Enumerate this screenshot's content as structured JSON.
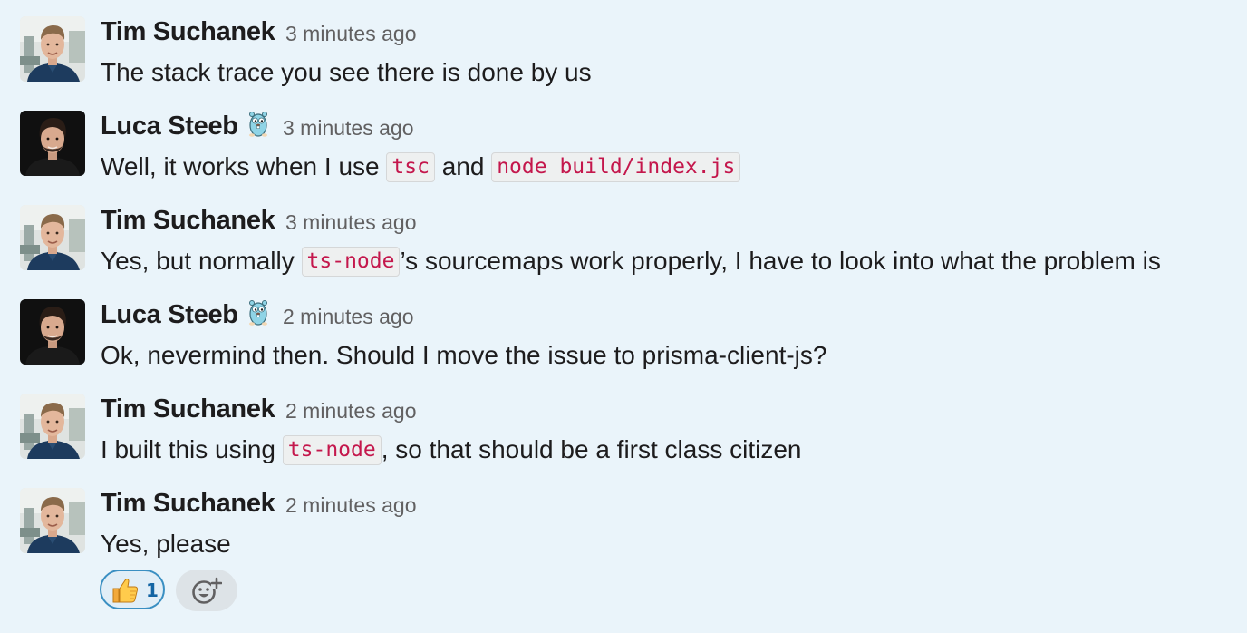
{
  "messages": [
    {
      "author": "Tim Suchanek",
      "avatar_icon": "avatar-tim-suchanek",
      "timestamp": "3 minutes ago",
      "text_before": "The stack trace you see there is done by us"
    },
    {
      "author": "Luca Steeb",
      "avatar_icon": "avatar-luca-steeb",
      "status_emoji": "gopher-emoji",
      "timestamp": "3 minutes ago",
      "text_before": "Well, it works when I use ",
      "code_1": "tsc",
      "text_middle": " and ",
      "code_2": "node build/index.js"
    },
    {
      "author": "Tim Suchanek",
      "avatar_icon": "avatar-tim-suchanek",
      "timestamp": "3 minutes ago",
      "text_before": "Yes, but normally ",
      "code_1": "ts-node",
      "text_after": "’s sourcemaps work properly, I have to look into what the problem is"
    },
    {
      "author": "Luca Steeb",
      "avatar_icon": "avatar-luca-steeb",
      "status_emoji": "gopher-emoji",
      "timestamp": "2 minutes ago",
      "text_before": "Ok, nevermind then. Should I move the issue to prisma-client-js?"
    },
    {
      "author": "Tim Suchanek",
      "avatar_icon": "avatar-tim-suchanek",
      "timestamp": "2 minutes ago",
      "text_before": "I built this using ",
      "code_1": "ts-node",
      "text_after": ", so that should be a first class citizen"
    },
    {
      "author": "Tim Suchanek",
      "avatar_icon": "avatar-tim-suchanek",
      "timestamp": "2 minutes ago",
      "text_before": "Yes, please"
    }
  ],
  "reactions": [
    {
      "emoji": "thumbs-up-icon",
      "count": "1"
    }
  ],
  "add_reaction_icon": "add-reaction-icon",
  "colors": {
    "background": "#eaf4fa",
    "code_text": "#c4174c",
    "reaction_border": "#3a8fc2",
    "timestamp": "#616061"
  }
}
